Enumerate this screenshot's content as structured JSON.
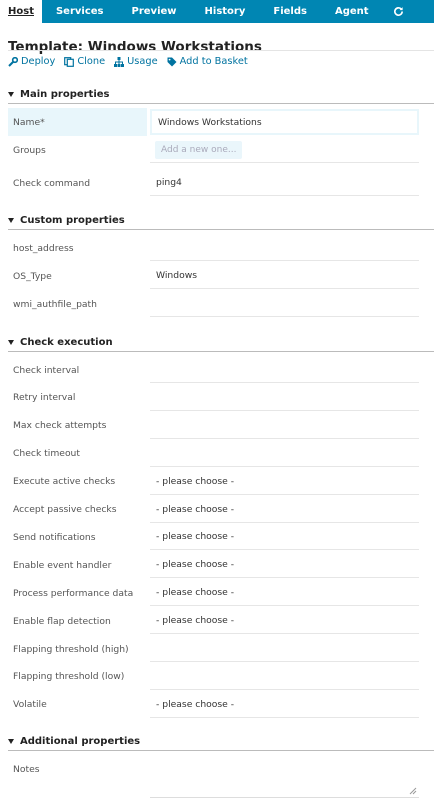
{
  "tabs": [
    {
      "label": "Host",
      "active": true
    },
    {
      "label": "Services"
    },
    {
      "label": "Preview"
    },
    {
      "label": "History"
    },
    {
      "label": "Fields"
    },
    {
      "label": "Agent"
    }
  ],
  "refresh_icon": "refresh-icon",
  "title": "Template: Windows Workstations",
  "actions": [
    {
      "label": "Deploy",
      "icon": "wrench-icon"
    },
    {
      "label": "Clone",
      "icon": "copy-icon"
    },
    {
      "label": "Usage",
      "icon": "sitemap-icon"
    },
    {
      "label": "Add to Basket",
      "icon": "tag-icon"
    }
  ],
  "sections": {
    "main": {
      "label": "Main properties"
    },
    "custom": {
      "label": "Custom properties"
    },
    "check": {
      "label": "Check execution"
    },
    "additional": {
      "label": "Additional properties"
    }
  },
  "main_fields": {
    "name": {
      "label": "Name*",
      "value": "Windows Workstations"
    },
    "groups": {
      "label": "Groups",
      "placeholder": "Add a new one..."
    },
    "check_command": {
      "label": "Check command",
      "value": "ping4"
    }
  },
  "custom_fields": {
    "host_address": {
      "label": "host_address",
      "value": ""
    },
    "os_type": {
      "label": "OS_Type",
      "value": "Windows"
    },
    "wmi": {
      "label": "wmi_authfile_path",
      "value": ""
    }
  },
  "check_fields": [
    {
      "label": "Check interval",
      "value": ""
    },
    {
      "label": "Retry interval",
      "value": ""
    },
    {
      "label": "Max check attempts",
      "value": ""
    },
    {
      "label": "Check timeout",
      "value": ""
    },
    {
      "label": "Execute active checks",
      "value": "- please choose -"
    },
    {
      "label": "Accept passive checks",
      "value": "- please choose -"
    },
    {
      "label": "Send notifications",
      "value": "- please choose -"
    },
    {
      "label": "Enable event handler",
      "value": "- please choose -"
    },
    {
      "label": "Process performance data",
      "value": "- please choose -"
    },
    {
      "label": "Enable flap detection",
      "value": "- please choose -"
    },
    {
      "label": "Flapping threshold (high)",
      "value": ""
    },
    {
      "label": "Flapping threshold (low)",
      "value": ""
    },
    {
      "label": "Volatile",
      "value": "- please choose -"
    }
  ],
  "additional_fields": {
    "notes": {
      "label": "Notes",
      "value": ""
    }
  },
  "colors": {
    "tab_bar": "#0086b3",
    "link": "#0073a0",
    "focus": "#e8f6fb"
  }
}
